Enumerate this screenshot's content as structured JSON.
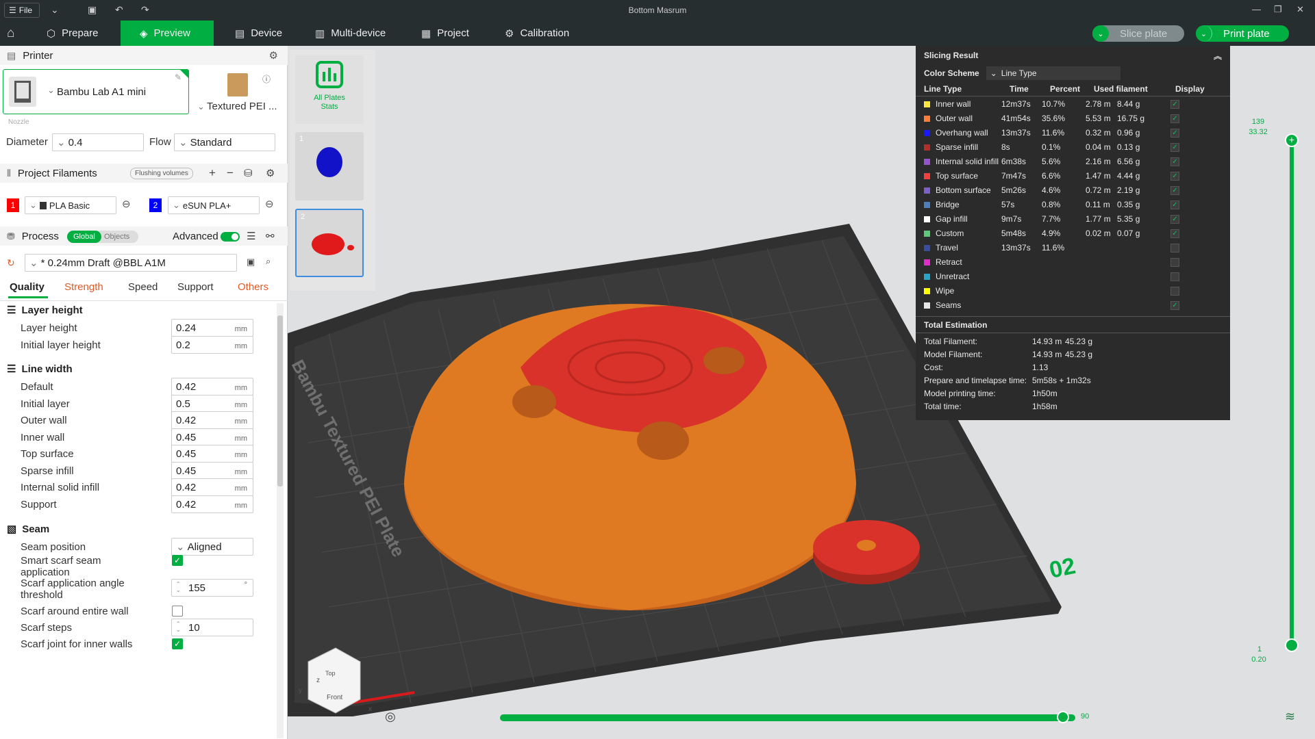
{
  "window": {
    "title": "Bottom Masrum",
    "file_label": "File"
  },
  "tabs": [
    {
      "label": "Prepare"
    },
    {
      "label": "Preview"
    },
    {
      "label": "Device"
    },
    {
      "label": "Multi-device"
    },
    {
      "label": "Project"
    },
    {
      "label": "Calibration"
    }
  ],
  "toolbar": {
    "slice_label": "Slice plate",
    "print_label": "Print plate"
  },
  "printer": {
    "section": "Printer",
    "name": "Bambu Lab A1 mini",
    "plate": "Textured PEI ...",
    "nozzle_label": "Nozzle",
    "diameter_label": "Diameter",
    "diameter": "0.4",
    "flow_label": "Flow",
    "flow": "Standard"
  },
  "filaments": {
    "section": "Project Filaments",
    "flushing": "Flushing volumes",
    "items": [
      {
        "num": "1",
        "name": "PLA Basic",
        "color": "#ff0000"
      },
      {
        "num": "2",
        "name": "eSUN PLA+",
        "color": "#0000ff"
      }
    ]
  },
  "process": {
    "section": "Process",
    "global": "Global",
    "objects": "Objects",
    "advanced": "Advanced",
    "preset": "* 0.24mm Draft @BBL A1M"
  },
  "subtabs": [
    "Quality",
    "Strength",
    "Speed",
    "Support",
    "Others"
  ],
  "quality": {
    "layer_height_title": "Layer height",
    "layer_height": [
      {
        "label": "Layer height",
        "value": "0.24",
        "unit": "mm"
      },
      {
        "label": "Initial layer height",
        "value": "0.2",
        "unit": "mm"
      }
    ],
    "line_width_title": "Line width",
    "line_width": [
      {
        "label": "Default",
        "value": "0.42",
        "unit": "mm"
      },
      {
        "label": "Initial layer",
        "value": "0.5",
        "unit": "mm"
      },
      {
        "label": "Outer wall",
        "value": "0.42",
        "unit": "mm"
      },
      {
        "label": "Inner wall",
        "value": "0.45",
        "unit": "mm"
      },
      {
        "label": "Top surface",
        "value": "0.45",
        "unit": "mm"
      },
      {
        "label": "Sparse infill",
        "value": "0.45",
        "unit": "mm"
      },
      {
        "label": "Internal solid infill",
        "value": "0.42",
        "unit": "mm"
      },
      {
        "label": "Support",
        "value": "0.42",
        "unit": "mm"
      }
    ],
    "seam_title": "Seam",
    "seam_position_label": "Seam position",
    "seam_position": "Aligned",
    "smart_scarf_label_1": "Smart scarf seam",
    "smart_scarf_label_2": "application",
    "scarf_angle_label_1": "Scarf application angle",
    "scarf_angle_label_2": "threshold",
    "scarf_angle": "155",
    "scarf_angle_unit": "°",
    "scarf_entire_label": "Scarf around entire wall",
    "scarf_steps_label": "Scarf steps",
    "scarf_steps": "10",
    "scarf_inner_label": "Scarf joint for inner walls"
  },
  "plates": {
    "all_label_1": "All Plates",
    "all_label_2": "Stats",
    "plate1": "1",
    "plate2": "2"
  },
  "result": {
    "title": "Slicing Result",
    "scheme_label": "Color Scheme",
    "scheme": "Line Type",
    "cols": [
      "Line Type",
      "Time",
      "Percent",
      "Used filament",
      "Display"
    ],
    "rows": [
      {
        "name": "Inner wall",
        "color": "#ffe640",
        "time": "12m37s",
        "pct": "10.7%",
        "len": "2.78 m",
        "g": "8.44 g",
        "show": true
      },
      {
        "name": "Outer wall",
        "color": "#ff7d38",
        "time": "41m54s",
        "pct": "35.6%",
        "len": "5.53 m",
        "g": "16.75 g",
        "show": true
      },
      {
        "name": "Overhang wall",
        "color": "#1919ff",
        "time": "13m37s",
        "pct": "11.6%",
        "len": "0.32 m",
        "g": "0.96 g",
        "show": true
      },
      {
        "name": "Sparse infill",
        "color": "#b03029",
        "time": "8s",
        "pct": "0.1%",
        "len": "0.04 m",
        "g": "0.13 g",
        "show": true
      },
      {
        "name": "Internal solid infill",
        "color": "#9654cc",
        "time": "6m38s",
        "pct": "5.6%",
        "len": "2.16 m",
        "g": "6.56 g",
        "show": true
      },
      {
        "name": "Top surface",
        "color": "#f04040",
        "time": "7m47s",
        "pct": "6.6%",
        "len": "1.47 m",
        "g": "4.44 g",
        "show": true
      },
      {
        "name": "Bottom surface",
        "color": "#7d5fc8",
        "time": "5m26s",
        "pct": "4.6%",
        "len": "0.72 m",
        "g": "2.19 g",
        "show": true
      },
      {
        "name": "Bridge",
        "color": "#4d80ba",
        "time": "57s",
        "pct": "0.8%",
        "len": "0.11 m",
        "g": "0.35 g",
        "show": true
      },
      {
        "name": "Gap infill",
        "color": "#ffffff",
        "time": "9m7s",
        "pct": "7.7%",
        "len": "1.77 m",
        "g": "5.35 g",
        "show": true
      },
      {
        "name": "Custom",
        "color": "#5ec779",
        "time": "5m48s",
        "pct": "4.9%",
        "len": "0.02 m",
        "g": "0.07 g",
        "show": true
      },
      {
        "name": "Travel",
        "color": "#384e9c",
        "time": "13m37s",
        "pct": "11.6%",
        "len": "",
        "g": "",
        "show": false
      },
      {
        "name": "Retract",
        "color": "#e02cc8",
        "time": "",
        "pct": "",
        "len": "",
        "g": "",
        "show": false
      },
      {
        "name": "Unretract",
        "color": "#2aa3c8",
        "time": "",
        "pct": "",
        "len": "",
        "g": "",
        "show": false
      },
      {
        "name": "Wipe",
        "color": "#ffff00",
        "time": "",
        "pct": "",
        "len": "",
        "g": "",
        "show": false
      },
      {
        "name": "Seams",
        "color": "#e6e6e6",
        "time": "",
        "pct": "",
        "len": "",
        "g": "",
        "show": true
      }
    ],
    "est_title": "Total Estimation",
    "est": [
      {
        "label": "Total Filament:",
        "v1": "14.93 m",
        "v2": "45.23 g"
      },
      {
        "label": "Model Filament:",
        "v1": "14.93 m",
        "v2": "45.23 g"
      },
      {
        "label": "Cost:",
        "v1": "1.13",
        "v2": ""
      },
      {
        "label": "Prepare and timelapse time:",
        "v1": "5m58s + 1m32s",
        "v2": ""
      },
      {
        "label": "Model printing time:",
        "v1": "1h50m",
        "v2": ""
      },
      {
        "label": "Total time:",
        "v1": "1h58m",
        "v2": ""
      }
    ]
  },
  "slider": {
    "top_layer": "139",
    "top_height": "33.32",
    "bottom_layer": "1",
    "bottom_height": "0.20",
    "horizontal_value": "90"
  },
  "bed": {
    "label": "Bambu Textured PEI Plate",
    "number": "02"
  },
  "cube": {
    "top": "Top",
    "front": "Front"
  },
  "axes": {
    "x": "x",
    "y": "y",
    "z": "z"
  },
  "colors": {
    "accent": "#00ae42",
    "model_orange": "#e07a22",
    "model_red": "#d8322a"
  }
}
